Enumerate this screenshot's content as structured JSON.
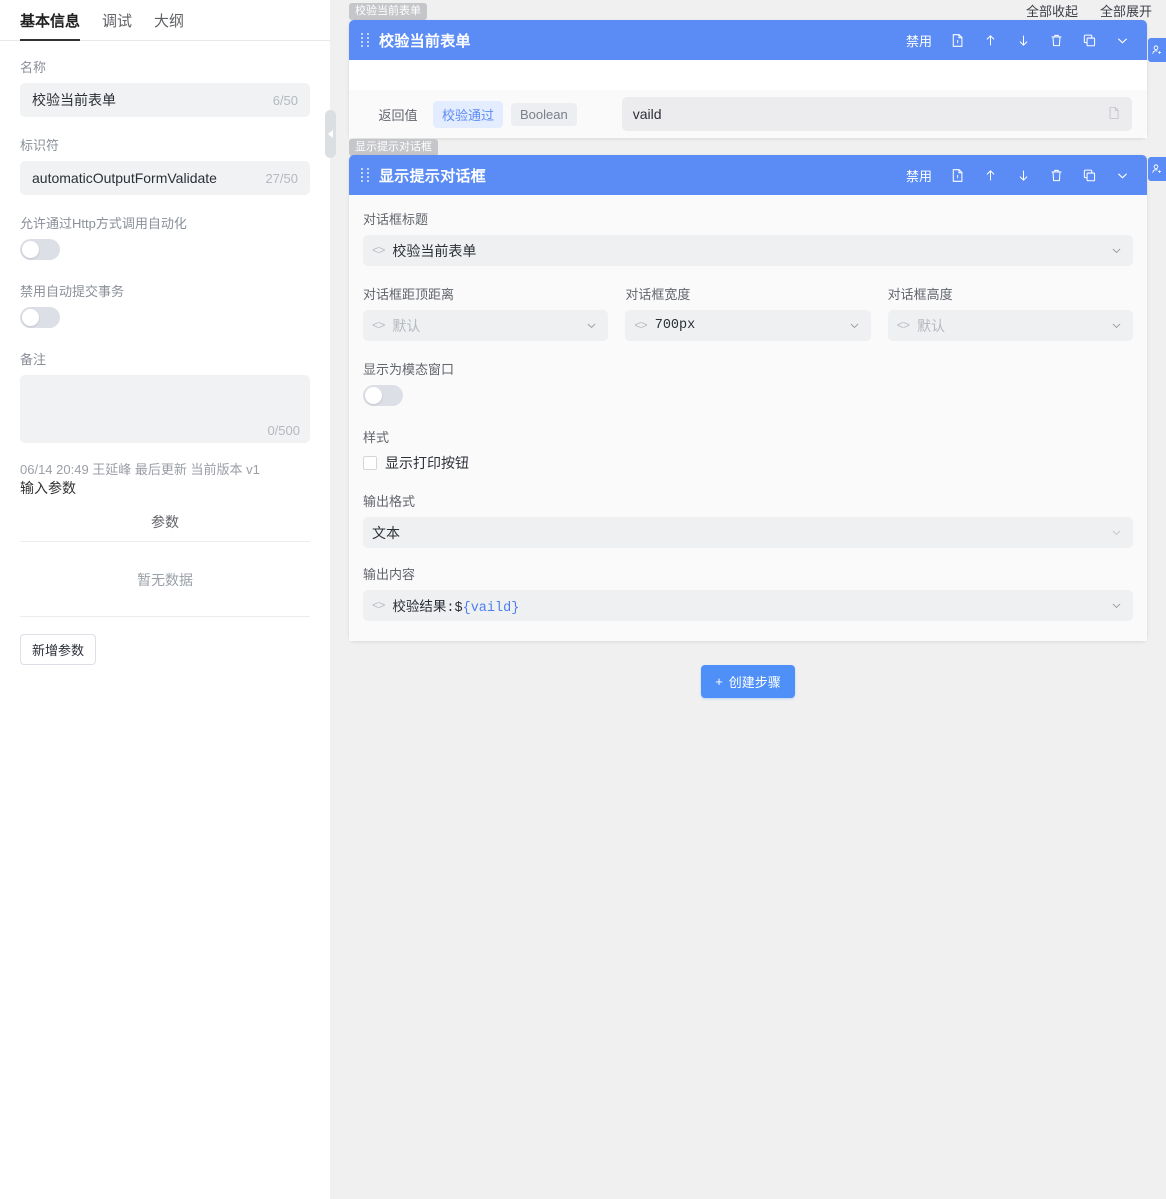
{
  "left_panel": {
    "tabs": [
      {
        "label": "基本信息",
        "active": true
      },
      {
        "label": "调试",
        "active": false
      },
      {
        "label": "大纲",
        "active": false
      }
    ],
    "name_label": "名称",
    "name_value": "校验当前表单",
    "name_counter": "6/50",
    "ident_label": "标识符",
    "ident_value": "automaticOutputFormValidate",
    "ident_counter": "27/50",
    "http_toggle_label": "允许通过Http方式调用自动化",
    "http_toggle_state": "off",
    "transaction_toggle_label": "禁用自动提交事务",
    "transaction_toggle_state": "off",
    "remark_label": "备注",
    "remark_value": "",
    "remark_counter": "0/500",
    "meta_text": "06/14 20:49 王延峰 最后更新 当前版本 v1",
    "input_params_title": "输入参数",
    "param_column_header": "参数",
    "param_empty_text": "暂无数据",
    "add_param_label": "新增参数"
  },
  "right_panel": {
    "collapse_all_label": "全部收起",
    "expand_all_label": "全部展开",
    "cards": [
      {
        "tag": "校验当前表单",
        "title": "校验当前表单",
        "disable_label": "禁用",
        "icons": [
          "note-icon",
          "arrow-up-icon",
          "arrow-down-icon",
          "trash-icon",
          "copy-icon",
          "chevron-down-icon"
        ],
        "return_row": {
          "label": "返回值",
          "chip_blue": "校验通过",
          "chip_gray": "Boolean",
          "input_value": "vaild",
          "input_icon": "note-icon"
        }
      },
      {
        "tag": "显示提示对话框",
        "title": "显示提示对话框",
        "disable_label": "禁用",
        "icons": [
          "note-icon",
          "arrow-up-icon",
          "arrow-down-icon",
          "trash-icon",
          "copy-icon",
          "chevron-down-icon"
        ],
        "fields": {
          "dialog_title_label": "对话框标题",
          "dialog_title_value": "校验当前表单",
          "top_distance_label": "对话框距顶距离",
          "top_distance_placeholder": "默认",
          "width_label": "对话框宽度",
          "width_value": "700px",
          "height_label": "对话框高度",
          "height_placeholder": "默认",
          "modal_label": "显示为模态窗口",
          "modal_state": "off",
          "style_label": "样式",
          "print_button_label": "显示打印按钮",
          "print_button_checked": false,
          "output_format_label": "输出格式",
          "output_format_value": "文本",
          "output_content_label": "输出内容",
          "output_content_prefix": "校验结果:$",
          "output_content_expr": "{vaild}"
        }
      }
    ],
    "create_step_label": "创建步骤",
    "create_step_plus": "+"
  },
  "colors": {
    "accent": "#5b8cf5",
    "primary_button": "#4e90f7",
    "panel_bg": "#f0f0f0",
    "field_bg": "#f1f2f4"
  }
}
